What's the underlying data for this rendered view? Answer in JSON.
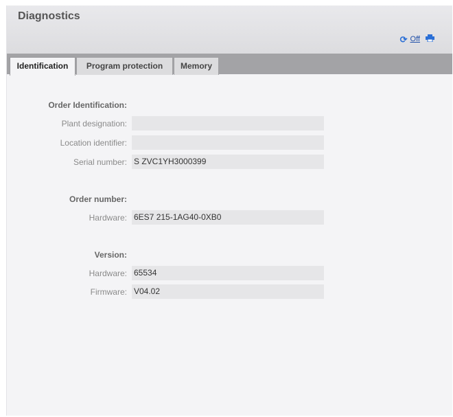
{
  "window": {
    "title": "Diagnostics"
  },
  "toolbar": {
    "refresh_icon": "refresh-icon",
    "off_label": "Off",
    "print_icon": "print-icon"
  },
  "tabs": [
    {
      "label": "Identification",
      "active": true
    },
    {
      "label": "Program protection",
      "active": false
    },
    {
      "label": "Memory",
      "active": false
    }
  ],
  "identification": {
    "order_identification": {
      "heading": "Order Identification:",
      "plant_designation": {
        "label": "Plant designation:",
        "value": ""
      },
      "location_identifier": {
        "label": "Location identifier:",
        "value": ""
      },
      "serial_number": {
        "label": "Serial number:",
        "value": "S ZVC1YH3000399"
      }
    },
    "order_number": {
      "heading": "Order number:",
      "hardware": {
        "label": "Hardware:",
        "value": "6ES7 215-1AG40-0XB0"
      }
    },
    "version": {
      "heading": "Version:",
      "hardware": {
        "label": "Hardware:",
        "value": "65534"
      },
      "firmware": {
        "label": "Firmware:",
        "value": "V04.02"
      }
    }
  },
  "colors": {
    "header_bg": "#e3e3e6",
    "tabbar_bg": "#a3a3a6",
    "panel_bg": "#f4f4f6",
    "field_bg": "#e6e6e8",
    "link": "#1f4fa8"
  }
}
